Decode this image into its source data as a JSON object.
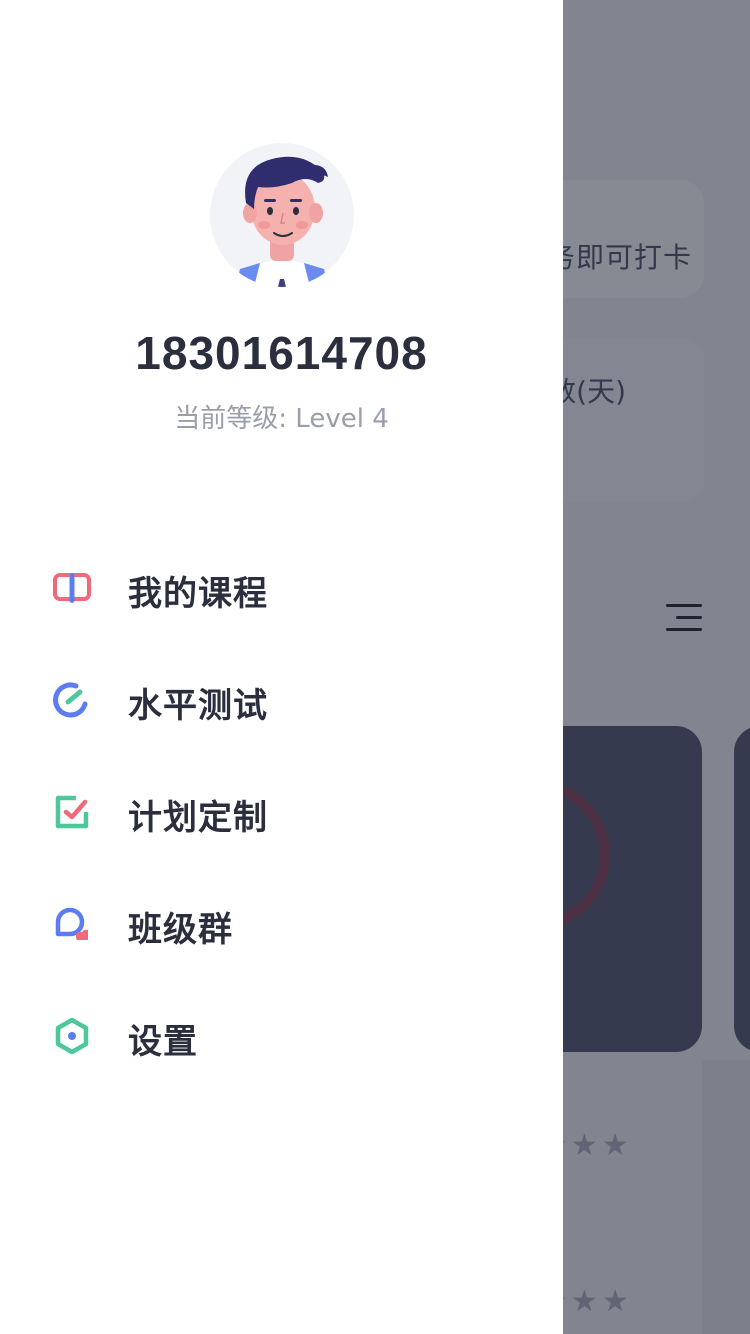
{
  "background": {
    "task_hint_fragment": "务即可打卡",
    "stat_label_fragment": "数(天)",
    "course_rating_stars": "★★★",
    "course_rating_stars_2": "★★★"
  },
  "profile": {
    "phone": "18301614708",
    "level_label": "当前等级:",
    "level_value": "Level 4",
    "avatar_icon": "user-avatar-illustration"
  },
  "menu": {
    "items": [
      {
        "label": "我的课程",
        "icon": "courses-icon",
        "color": "#ee6b7b"
      },
      {
        "label": "水平测试",
        "icon": "test-icon",
        "color": "#5b7cf3"
      },
      {
        "label": "计划定制",
        "icon": "plan-icon",
        "color": "#4ec79a"
      },
      {
        "label": "班级群",
        "icon": "class-group-icon",
        "color": "#5b7cf3"
      },
      {
        "label": "设置",
        "icon": "settings-icon",
        "color": "#4ec79a"
      }
    ]
  },
  "colors": {
    "text_primary": "#2a2e3d",
    "text_secondary": "#9a9eab",
    "overlay": "rgba(18,22,40,0.5)"
  }
}
